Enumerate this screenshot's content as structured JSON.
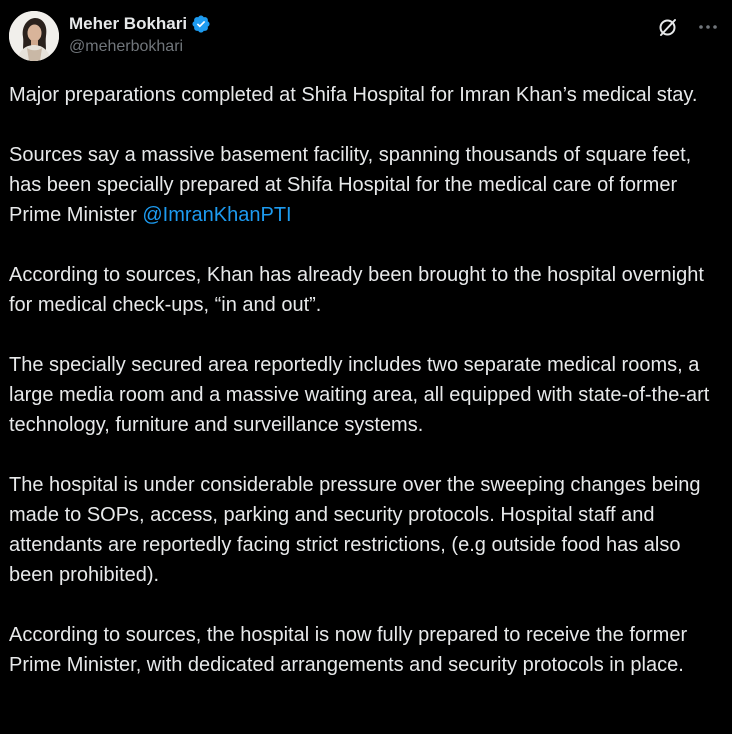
{
  "author": {
    "display_name": "Meher Bokhari",
    "handle": "@meherbokhari",
    "verified": true,
    "verified_color": "#1d9bf0"
  },
  "header_actions": [
    {
      "icon": "grok-icon"
    },
    {
      "icon": "more-icon"
    }
  ],
  "tweet": {
    "p1": "Major preparations completed at Shifa Hospital for Imran Khan’s medical stay.",
    "p2_text": "Sources say a massive basement facility, spanning thousands of square feet, has been specially prepared at Shifa Hospital for the medical care of former Prime Minister ",
    "p2_mention": "@ImranKhanPTI",
    "p3": "According to sources, Khan has already been brought to the hospital overnight for medical check-ups, “in and out”.",
    "p4": "The specially secured area reportedly includes two separate medical rooms, a large media room and a massive waiting area, all equipped with state-of-the-art technology, furniture and surveillance systems.",
    "p5": "The hospital is under considerable pressure over the sweeping changes being made to SOPs, access, parking and security protocols. Hospital staff and attendants are reportedly facing strict restrictions, (e.g outside food has also been prohibited).",
    "p6": "According to sources, the hospital is now fully prepared to receive the former Prime Minister, with dedicated arrangements and security protocols in place."
  },
  "colors": {
    "background": "#000000",
    "text": "#e7e9ea",
    "secondary_text": "#71767b",
    "link": "#1d9bf0"
  }
}
